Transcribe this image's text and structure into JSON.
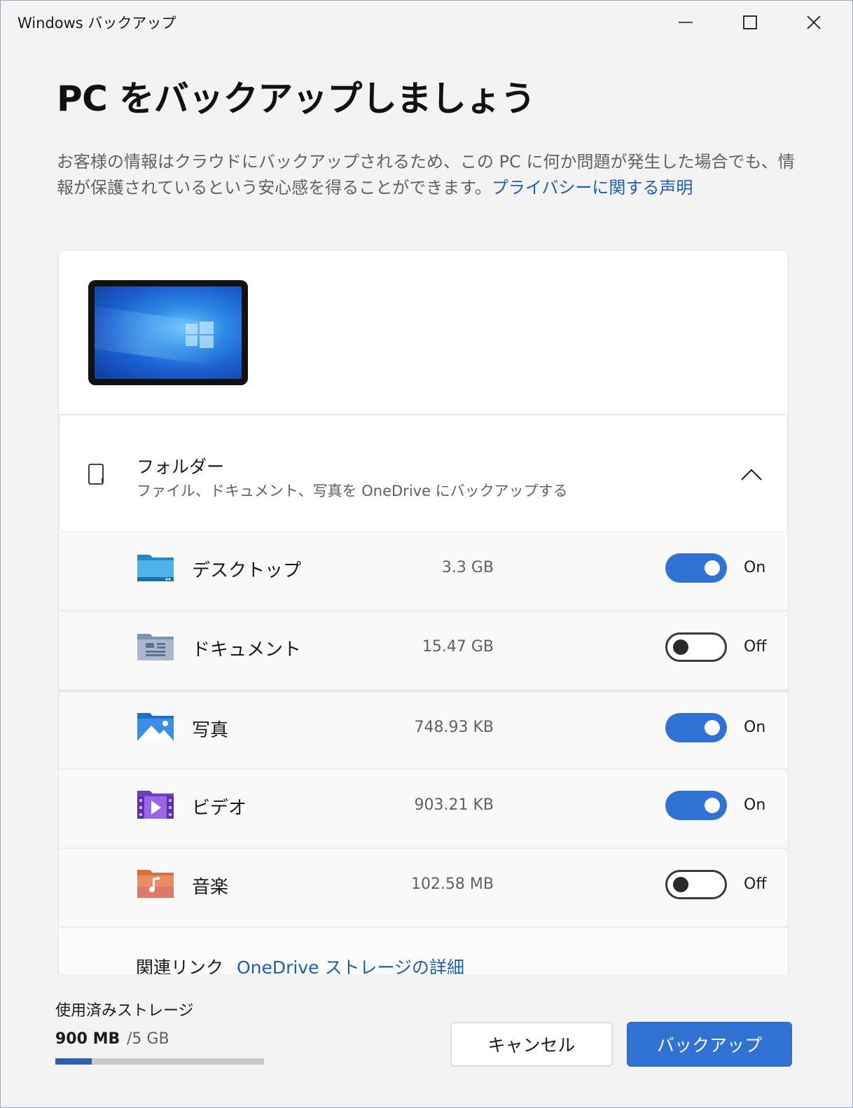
{
  "window": {
    "title": "Windows バックアップ"
  },
  "page": {
    "title": "PC をバックアップしましょう",
    "description": "お客様の情報はクラウドにバックアップされるため、この PC に何か問題が発生した場合でも、情報が保護されているという安心感を得ることができます。",
    "privacy_link": "プライバシーに関する声明"
  },
  "folders": {
    "title": "フォルダー",
    "subtitle": "ファイル、ドキュメント、写真を OneDrive にバックアップする",
    "items": [
      {
        "name": "デスクトップ",
        "size": "3.3 GB",
        "enabled": true,
        "state_label": "On"
      },
      {
        "name": "ドキュメント",
        "size": "15.47 GB",
        "enabled": false,
        "state_label": "Off"
      },
      {
        "name": "写真",
        "size": "748.93 KB",
        "enabled": true,
        "state_label": "On"
      },
      {
        "name": "ビデオ",
        "size": "903.21 KB",
        "enabled": true,
        "state_label": "On"
      },
      {
        "name": "音楽",
        "size": "102.58 MB",
        "enabled": false,
        "state_label": "Off"
      }
    ]
  },
  "related": {
    "label": "関連リンク",
    "link": "OneDrive ストレージの詳細"
  },
  "storage": {
    "label": "使用済みストレージ",
    "used": "900 MB",
    "total": "/5 GB",
    "fraction": 0.176
  },
  "buttons": {
    "cancel": "キャンセル",
    "backup": "バックアップ"
  },
  "colors": {
    "accent": "#2f72d4",
    "link": "#1a5fb4",
    "progress": "#2f5fb3"
  }
}
